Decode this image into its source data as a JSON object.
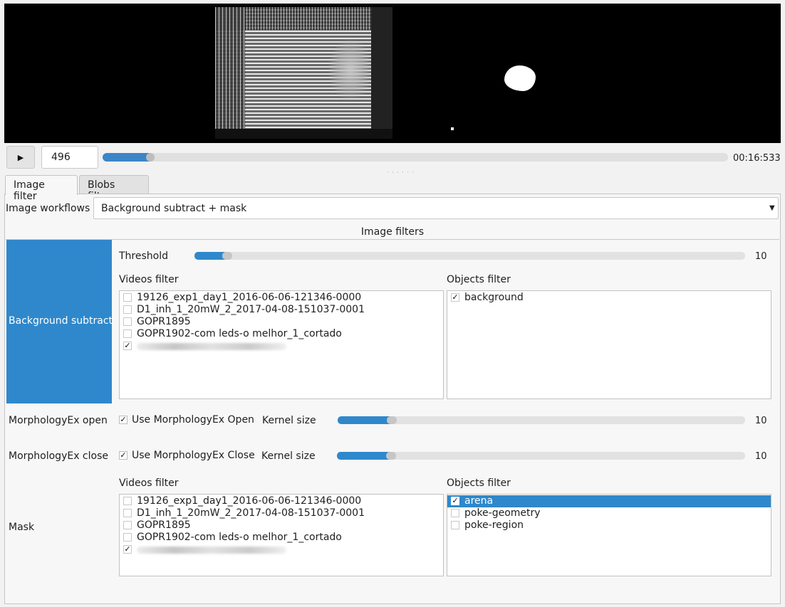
{
  "player": {
    "play_icon": "▶",
    "frame_value": "496",
    "time": "00:16:533",
    "progress": 0.07
  },
  "tabs": [
    {
      "label": "Image filter",
      "active": true
    },
    {
      "label": "Blobs filter",
      "active": false
    }
  ],
  "workflow": {
    "label": "Image workflows",
    "selected": "Background subtract + mask"
  },
  "filters_title": "Image filters",
  "background_subtract": {
    "label": "Background subtract",
    "threshold_label": "Threshold",
    "threshold_value": "10",
    "threshold_fraction": 0.05,
    "videos_filter_label": "Videos filter",
    "objects_filter_label": "Objects filter",
    "videos": [
      {
        "name": "19126_exp1_day1_2016-06-06-121346-0000",
        "checked": false
      },
      {
        "name": "D1_inh_1_20mW_2_2017-04-08-151037-0001",
        "checked": false
      },
      {
        "name": "GOPR1895",
        "checked": false
      },
      {
        "name": "GOPR1902-com leds-o melhor_1_cortado",
        "checked": false
      },
      {
        "name": "",
        "checked": true,
        "redacted": true
      }
    ],
    "objects": [
      {
        "name": "background",
        "checked": true
      }
    ]
  },
  "morph_open": {
    "label": "MorphologyEx open",
    "checkbox_label": "Use MorphologyEx Open",
    "kernel_label": "Kernel size",
    "kernel_value": "10",
    "kernel_fraction": 0.12
  },
  "morph_close": {
    "label": "MorphologyEx close",
    "checkbox_label": "Use MorphologyEx Close",
    "kernel_label": "Kernel size",
    "kernel_value": "10",
    "kernel_fraction": 0.12
  },
  "mask": {
    "label": "Mask",
    "videos_filter_label": "Videos filter",
    "objects_filter_label": "Objects filter",
    "videos": [
      {
        "name": "19126_exp1_day1_2016-06-06-121346-0000",
        "checked": false
      },
      {
        "name": "D1_inh_1_20mW_2_2017-04-08-151037-0001",
        "checked": false
      },
      {
        "name": "GOPR1895",
        "checked": false
      },
      {
        "name": "GOPR1902-com leds-o melhor_1_cortado",
        "checked": false
      },
      {
        "name": "",
        "checked": true,
        "redacted": true
      }
    ],
    "objects": [
      {
        "name": "arena",
        "checked": true,
        "highlighted": true
      },
      {
        "name": "poke-geometry",
        "checked": false
      },
      {
        "name": "poke-region",
        "checked": false
      }
    ]
  },
  "colors": {
    "accent": "#2f88cb",
    "video_bg": "#000000"
  },
  "check_mark": "✓"
}
